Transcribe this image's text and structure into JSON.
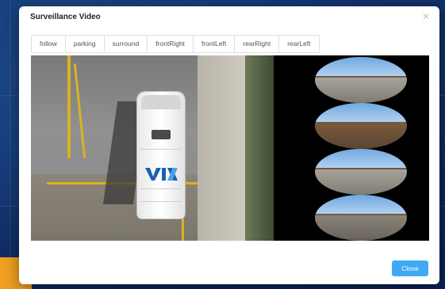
{
  "dialog": {
    "title": "Surveillance Video",
    "close_icon": "close-icon",
    "tabs": [
      {
        "label": "follow"
      },
      {
        "label": "parking"
      },
      {
        "label": "surround"
      },
      {
        "label": "frontRight"
      },
      {
        "label": "frontLeft"
      },
      {
        "label": "rearRight"
      },
      {
        "label": "rearLeft"
      }
    ],
    "close_button_label": "Close"
  },
  "colors": {
    "accent": "#3fa9f5",
    "backdrop": "#0f2a5c",
    "highlight": "#f0a020"
  }
}
